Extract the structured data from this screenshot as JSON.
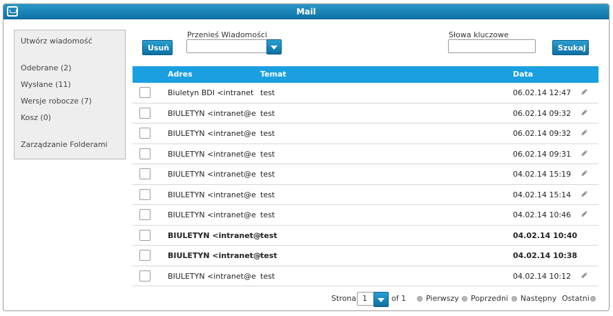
{
  "window": {
    "title": "Mail"
  },
  "sidebar": {
    "compose": "Utwórz wiadomość",
    "folders": [
      "Odebrane (2)",
      "Wysłane (11)",
      "Wersje robocze (7)",
      "Kosz (0)"
    ],
    "manage": "Zarządzanie Folderami"
  },
  "toolbar": {
    "delete_label": "Usuń",
    "move_label": "Przenieś Wiadomości",
    "move_value": "",
    "keywords_label": "Słowa kluczowe",
    "keywords_value": "",
    "search_label": "Szukaj"
  },
  "table": {
    "headers": {
      "address": "Adres",
      "subject": "Temat",
      "date": "Data"
    },
    "rows": [
      {
        "address": "Biuletyn BDI <intranet",
        "subject": "test",
        "date": "06.02.14 12:47",
        "unread": false,
        "attachment": true
      },
      {
        "address": "BIULETYN <intranet@e",
        "subject": "test",
        "date": "06.02.14 09:32",
        "unread": false,
        "attachment": true
      },
      {
        "address": "BIULETYN <intranet@e",
        "subject": "test",
        "date": "06.02.14 09:32",
        "unread": false,
        "attachment": true
      },
      {
        "address": "BIULETYN <intranet@e",
        "subject": "test",
        "date": "06.02.14 09:31",
        "unread": false,
        "attachment": true
      },
      {
        "address": "BIULETYN <intranet@e",
        "subject": "test",
        "date": "04.02.14 15:19",
        "unread": false,
        "attachment": true
      },
      {
        "address": "BIULETYN <intranet@e",
        "subject": "test",
        "date": "04.02.14 15:14",
        "unread": false,
        "attachment": true
      },
      {
        "address": "BIULETYN <intranet@e",
        "subject": "test",
        "date": "04.02.14 10:46",
        "unread": false,
        "attachment": true
      },
      {
        "address": "BIULETYN <intranet@",
        "subject": "test",
        "date": "04.02.14 10:40",
        "unread": true,
        "attachment": false
      },
      {
        "address": "BIULETYN <intranet@",
        "subject": "test",
        "date": "04.02.14 10:38",
        "unread": true,
        "attachment": false
      },
      {
        "address": "BIULETYN <intranet@e",
        "subject": "test",
        "date": "04.02.14 10:12",
        "unread": false,
        "attachment": true
      }
    ]
  },
  "pager": {
    "page_label": "Strona",
    "page_value": "1",
    "of_label": "of 1",
    "first": "Pierwszy",
    "prev": "Poprzedni",
    "next": "Następny",
    "last": "Ostatni"
  },
  "colors": {
    "accent": "#1aa0e0",
    "title_bar": "#0f72a6"
  },
  "icons": {
    "app": "mail-app-icon",
    "attachment": "paperclip-icon",
    "dropdown": "chevron-down-icon"
  }
}
